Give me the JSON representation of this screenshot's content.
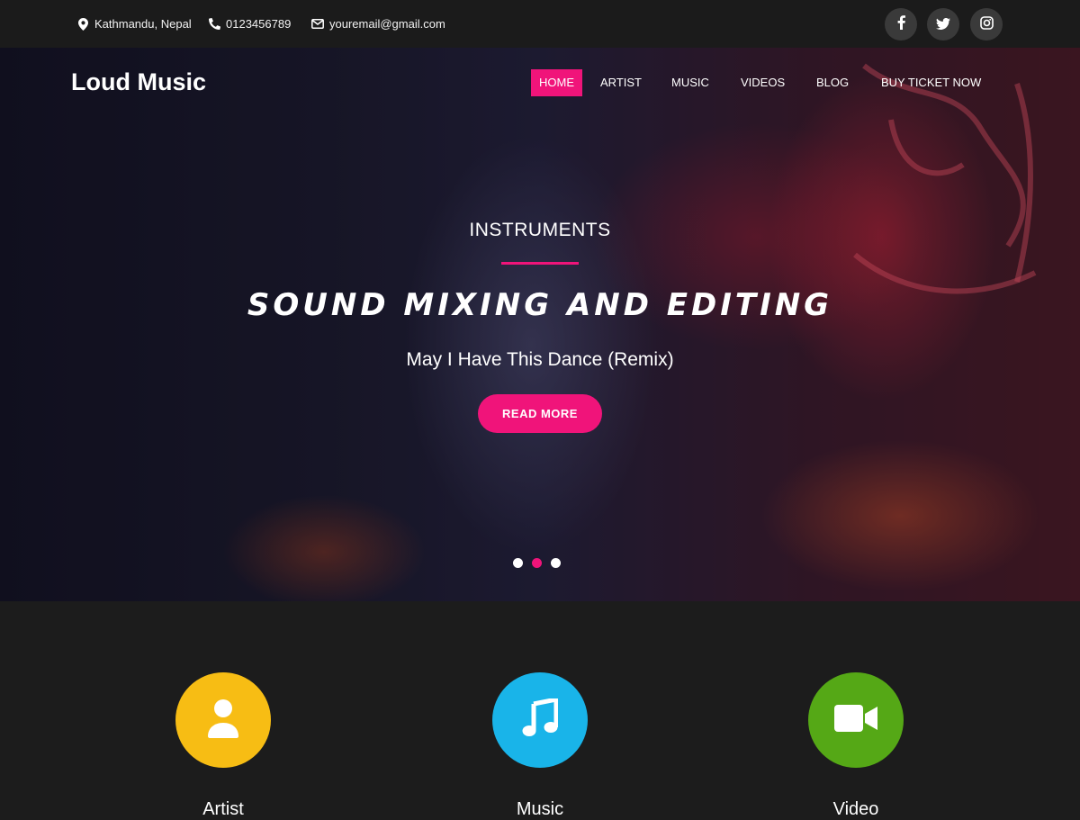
{
  "topbar": {
    "location": "Kathmandu, Nepal",
    "phone": "0123456789",
    "email": "youremail@gmail.com",
    "social": [
      "facebook-icon",
      "twitter-icon",
      "instagram-icon"
    ]
  },
  "header": {
    "brand": "Loud Music",
    "nav": [
      {
        "label": "HOME",
        "active": true
      },
      {
        "label": "ARTIST",
        "active": false
      },
      {
        "label": "MUSIC",
        "active": false
      },
      {
        "label": "VIDEOS",
        "active": false
      },
      {
        "label": "BLOG",
        "active": false
      },
      {
        "label": "BUY TICKET NOW",
        "active": false
      }
    ]
  },
  "hero": {
    "eyebrow": "INSTRUMENTS",
    "headline": "SOUND MIXING AND EDITING",
    "subhead": "May I Have This Dance (Remix)",
    "cta": "READ MORE",
    "slides": 3,
    "active_slide": 2
  },
  "features": [
    {
      "label": "Artist",
      "icon": "user-icon",
      "color": "#f7bd14"
    },
    {
      "label": "Music",
      "icon": "music-note-icon",
      "color": "#19b4e9"
    },
    {
      "label": "Video",
      "icon": "video-camera-icon",
      "color": "#55a816"
    }
  ],
  "colors": {
    "accent": "#f0147a",
    "topbar_bg": "#1b1b1b",
    "section_bg": "#1c1c1c"
  }
}
